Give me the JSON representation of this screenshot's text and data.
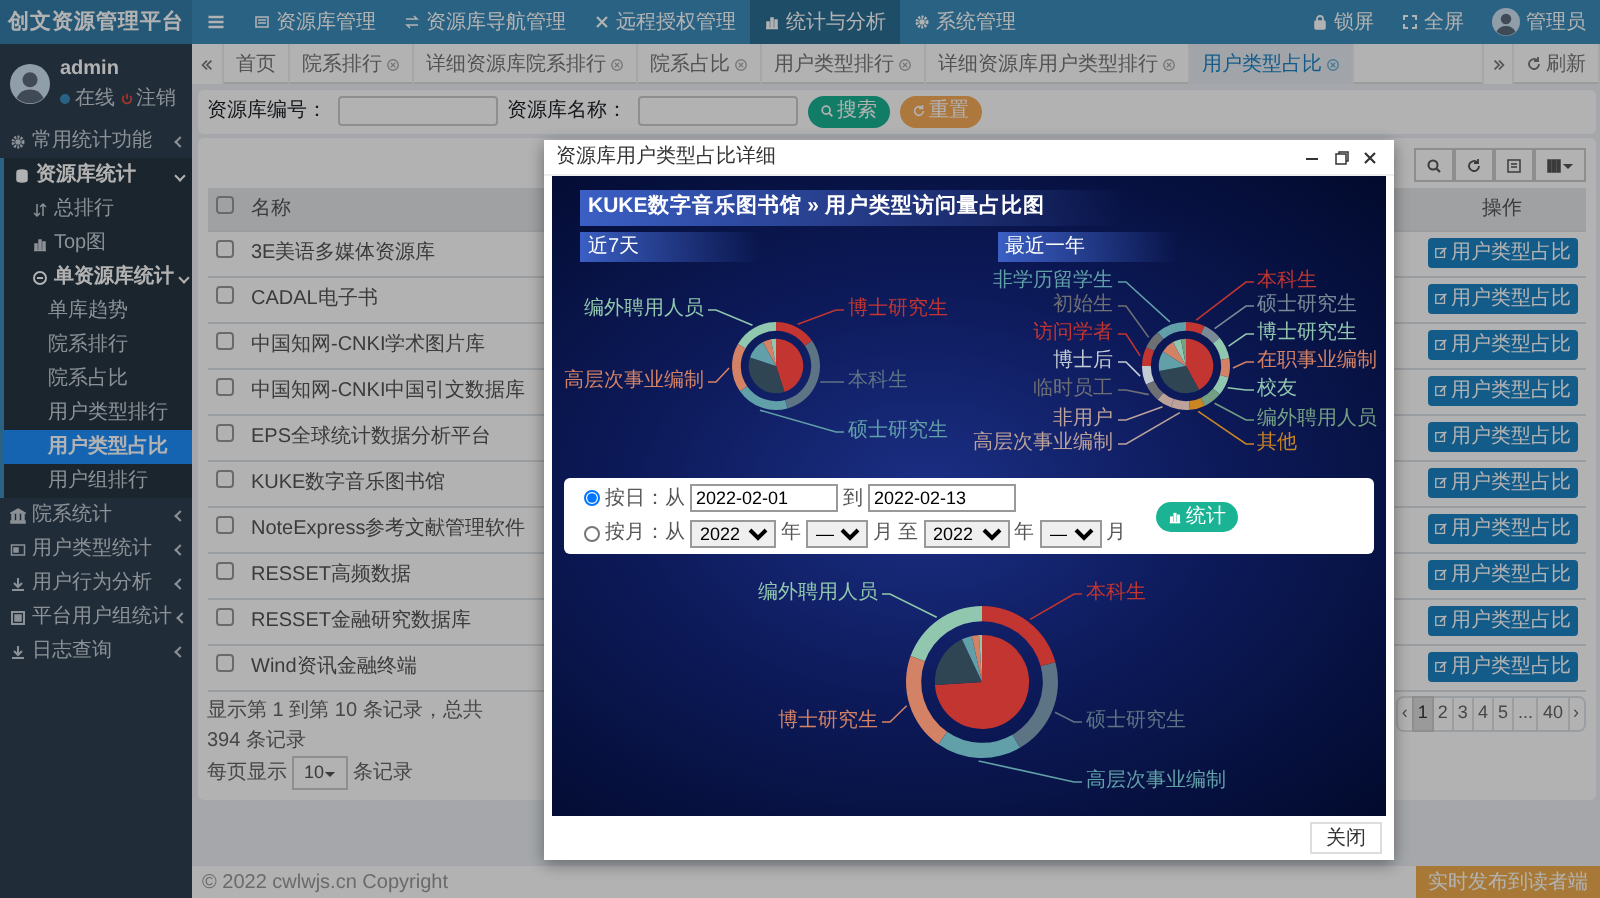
{
  "brand": "创文资源管理平台",
  "top_nav": [
    {
      "label": "资源库管理",
      "selected": false
    },
    {
      "label": "资源库导航管理",
      "selected": false
    },
    {
      "label": "远程授权管理",
      "selected": false
    },
    {
      "label": "统计与分析",
      "selected": true
    },
    {
      "label": "系统管理",
      "selected": false
    }
  ],
  "top_right": {
    "lock": "锁屏",
    "fullscreen": "全屏",
    "user": "管理员"
  },
  "user_panel": {
    "name": "admin",
    "status": "在线",
    "logout": "注销"
  },
  "sidebar": {
    "items": [
      {
        "label": "常用统计功能",
        "selected": false,
        "expanded": false
      },
      {
        "label": "资源库统计",
        "selected": false,
        "expanded": true,
        "children": [
          {
            "label": "总排行",
            "selected": false
          },
          {
            "label": "Top图",
            "selected": false
          },
          {
            "label": "单资源库统计",
            "selected": false,
            "expanded": true,
            "children": [
              {
                "label": "单库趋势",
                "selected": false
              },
              {
                "label": "院系排行",
                "selected": false
              },
              {
                "label": "院系占比",
                "selected": false
              },
              {
                "label": "用户类型排行",
                "selected": false
              },
              {
                "label": "用户类型占比",
                "selected": true
              },
              {
                "label": "用户组排行",
                "selected": false
              }
            ]
          }
        ]
      },
      {
        "label": "院系统计",
        "selected": false,
        "expanded": false
      },
      {
        "label": "用户类型统计",
        "selected": false,
        "expanded": false
      },
      {
        "label": "用户行为分析",
        "selected": false,
        "expanded": false
      },
      {
        "label": "平台用户组统计",
        "selected": false,
        "expanded": false
      },
      {
        "label": "日志查询",
        "selected": false,
        "expanded": false
      }
    ]
  },
  "tabs": [
    {
      "label": "首页",
      "selected": false,
      "closable": false
    },
    {
      "label": "院系排行",
      "selected": false,
      "closable": true
    },
    {
      "label": "详细资源库院系排行",
      "selected": false,
      "closable": true
    },
    {
      "label": "院系占比",
      "selected": false,
      "closable": true
    },
    {
      "label": "用户类型排行",
      "selected": false,
      "closable": true
    },
    {
      "label": "详细资源库用户类型排行",
      "selected": false,
      "closable": true
    },
    {
      "label": "用户类型占比",
      "selected": true,
      "closable": true
    }
  ],
  "refresh": "刷新",
  "search": {
    "fields": [
      {
        "label": "资源库编号："
      },
      {
        "label": "资源库名称："
      }
    ],
    "buttons": [
      "搜索",
      "重置"
    ]
  },
  "table": {
    "select_all": false,
    "columns": [
      "名称",
      "操作"
    ],
    "rows": [
      {
        "name": "3E美语多媒体资源库",
        "action": "用户类型占比",
        "checked": false
      },
      {
        "name": "CADAL电子书",
        "action": "用户类型占比",
        "checked": false
      },
      {
        "name": "中国知网-CNKI学术图片库",
        "action": "用户类型占比",
        "checked": false
      },
      {
        "name": "中国知网-CNKI中国引文数据库",
        "action": "用户类型占比",
        "checked": false
      },
      {
        "name": "EPS全球统计数据分析平台",
        "action": "用户类型占比",
        "checked": false
      },
      {
        "name": "KUKE数字音乐图书馆",
        "action": "用户类型占比",
        "checked": false
      },
      {
        "name": "NoteExpress参考文献管理软件",
        "action": "用户类型占比",
        "checked": false
      },
      {
        "name": "RESSET高频数据",
        "action": "用户类型占比",
        "checked": false
      },
      {
        "name": "RESSET金融研究数据库",
        "action": "用户类型占比",
        "checked": false
      },
      {
        "name": "Wind资讯金融终端",
        "action": "用户类型占比",
        "checked": false
      }
    ]
  },
  "pagination": {
    "info": "显示第 1 到第 10 条记录，总共 394 条记录",
    "per_page_label": "每页显示",
    "per_page": "10",
    "per_page_suffix": "条记录",
    "pages": [
      {
        "label": "‹",
        "selected": false
      },
      {
        "label": "1",
        "selected": true
      },
      {
        "label": "2",
        "selected": false
      },
      {
        "label": "3",
        "selected": false
      },
      {
        "label": "4",
        "selected": false
      },
      {
        "label": "5",
        "selected": false
      },
      {
        "label": "...",
        "selected": false
      },
      {
        "label": "40",
        "selected": false
      },
      {
        "label": "›",
        "selected": false
      }
    ]
  },
  "footer": {
    "copyright": "© 2022 cwlwjs.cn Copyright",
    "button": "实时发布到读者端"
  },
  "modal": {
    "title": "资源库用户类型占比详细",
    "heading": "KUKE数字音乐图书馆 » 用户类型访问量占比图",
    "panels": [
      {
        "title": "近7天",
        "labels": [
          {
            "text": "编外聘用人员",
            "color": "#91c7ae"
          },
          {
            "text": "博士研究生",
            "color": "#c23531"
          },
          {
            "text": "本科生",
            "color": "#5d7484"
          },
          {
            "text": "高层次事业编制",
            "color": "#d48265"
          },
          {
            "text": "硕士研究生",
            "color": "#61a0a8"
          }
        ]
      },
      {
        "title": "最近一年",
        "labels": [
          {
            "text": "非学历留学生",
            "color": "#61a0a8"
          },
          {
            "text": "本科生",
            "color": "#c23531"
          },
          {
            "text": "初始生",
            "color": "#6e7074"
          },
          {
            "text": "硕士研究生",
            "color": "#7a8a96"
          },
          {
            "text": "访问学者",
            "color": "#c23531"
          },
          {
            "text": "博士研究生",
            "color": "#91c7ae"
          },
          {
            "text": "博士后",
            "color": "#c4ccd3"
          },
          {
            "text": "在职事业编制",
            "color": "#d48265"
          },
          {
            "text": "临时员工",
            "color": "#6e7074"
          },
          {
            "text": "校友",
            "color": "#91c7ae"
          },
          {
            "text": "非用户",
            "color": "#bda29a"
          },
          {
            "text": "编外聘用人员",
            "color": "#749f83"
          },
          {
            "text": "高层次事业编制",
            "color": "#bda29a"
          },
          {
            "text": "其他",
            "color": "#ca8622"
          }
        ]
      }
    ],
    "form": {
      "rows": [
        {
          "selected": true,
          "parts": [
            {
              "kind": "text",
              "text": "按日：从"
            },
            {
              "kind": "input",
              "value": "2022-02-01"
            },
            {
              "kind": "text",
              "text": "到"
            },
            {
              "kind": "input",
              "value": "2022-02-13"
            }
          ]
        },
        {
          "selected": false,
          "parts": [
            {
              "kind": "text",
              "text": "按月：从"
            },
            {
              "kind": "select",
              "value": "2022"
            },
            {
              "kind": "text",
              "text": "年"
            },
            {
              "kind": "select",
              "value": "—"
            },
            {
              "kind": "text",
              "text": "月"
            },
            {
              "kind": "text",
              "text": "至"
            },
            {
              "kind": "select",
              "value": "2022"
            },
            {
              "kind": "text",
              "text": "年"
            },
            {
              "kind": "select",
              "value": "—"
            },
            {
              "kind": "text",
              "text": "月"
            }
          ]
        }
      ],
      "submit": "统计"
    },
    "bottom_chart": {
      "labels": [
        {
          "text": "编外聘用人员",
          "color": "#91c7ae"
        },
        {
          "text": "本科生",
          "color": "#c23531"
        },
        {
          "text": "博士研究生",
          "color": "#d48265"
        },
        {
          "text": "硕士研究生",
          "color": "#5d7484"
        },
        {
          "text": "高层次事业编制",
          "color": "#61a0a8"
        }
      ]
    },
    "close": "关闭"
  }
}
